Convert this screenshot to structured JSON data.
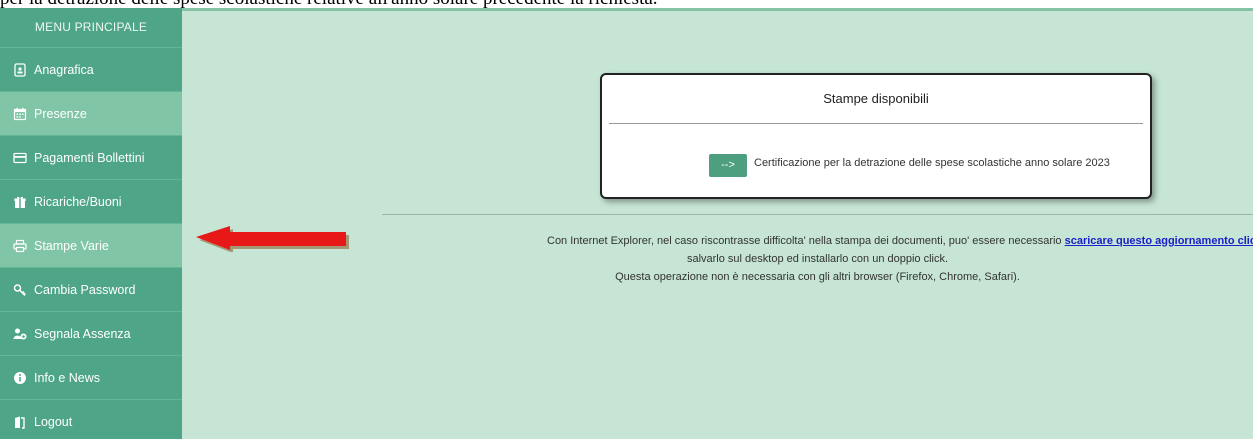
{
  "caption": "per la detrazione delle spese scolastiche relative all'anno solare precedente la richiesta.",
  "sidebar": {
    "title": "MENU PRINCIPALE",
    "items": [
      {
        "label": "Anagrafica",
        "icon": "id-card-icon"
      },
      {
        "label": "Presenze",
        "icon": "calendar-icon"
      },
      {
        "label": "Pagamenti Bollettini",
        "icon": "credit-card-icon"
      },
      {
        "label": "Ricariche/Buoni",
        "icon": "gift-icon"
      },
      {
        "label": "Stampe Varie",
        "icon": "printer-icon"
      },
      {
        "label": "Cambia Password",
        "icon": "key-icon"
      },
      {
        "label": "Segnala Assenza",
        "icon": "users-icon"
      },
      {
        "label": "Info e News",
        "icon": "info-icon"
      },
      {
        "label": "Logout",
        "icon": "logout-icon"
      }
    ]
  },
  "card": {
    "title": "Stampe disponibili",
    "button_label": "-->",
    "link_text": "Certificazione per la detrazione delle spese scolastiche anno solare 2023"
  },
  "notice": {
    "before_link": "Con Internet Explorer, nel caso riscontrasse difficolta' nella stampa dei documenti, puo' essere necessario ",
    "link": "scaricare questo aggiornamento cliccando qui",
    "after_link": ".",
    "line2": "salvarlo sul desktop ed installarlo con un doppio click.",
    "line3": "Questa operazione non è necessaria con gli altri browser (Firefox, Chrome, Safari)."
  },
  "colors": {
    "sidebar": "#4ea587",
    "sidebar_highlight": "#80c5a5",
    "main_background": "#c6e5d4",
    "button": "#4e9e80",
    "link": "#1a20c7",
    "arrow": "#e81818"
  }
}
